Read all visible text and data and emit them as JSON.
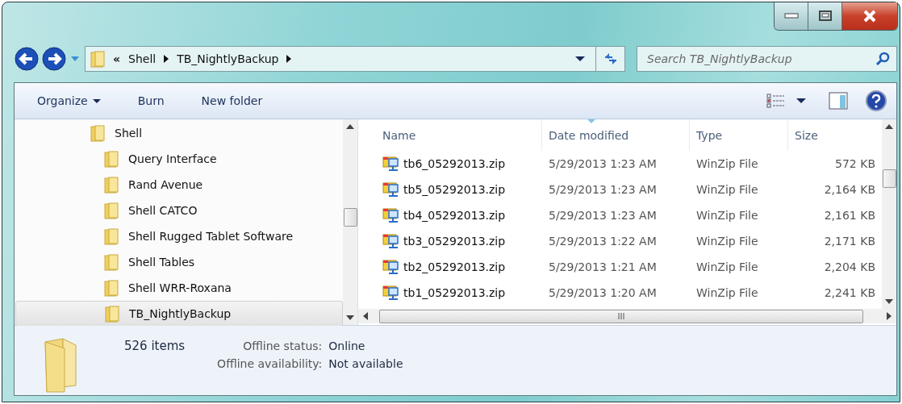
{
  "address": {
    "crumbs": [
      "«",
      "Shell",
      "TB_NightlyBackup"
    ]
  },
  "search": {
    "placeholder": "Search TB_NightlyBackup"
  },
  "toolbar": [
    {
      "label": "Organize",
      "dropdown": true
    },
    {
      "label": "Burn",
      "dropdown": false
    },
    {
      "label": "New folder",
      "dropdown": false
    }
  ],
  "tree": [
    {
      "label": "Shell",
      "selected": false,
      "children": [
        {
          "label": "Query Interface",
          "selected": false
        },
        {
          "label": "Rand Avenue",
          "selected": false
        },
        {
          "label": "Shell CATCO",
          "selected": false
        },
        {
          "label": "Shell Rugged Tablet Software",
          "selected": false
        },
        {
          "label": "Shell Tables",
          "selected": false
        },
        {
          "label": "Shell WRR-Roxana",
          "selected": false
        },
        {
          "label": "TB_NightlyBackup",
          "selected": true
        }
      ]
    }
  ],
  "table": {
    "columns": [
      {
        "label": "Name",
        "sorted": false
      },
      {
        "label": "Date modified",
        "sorted": true
      },
      {
        "label": "Type",
        "sorted": false
      },
      {
        "label": "Size",
        "sorted": false
      }
    ],
    "rows": [
      {
        "name": "tb6_05292013.zip",
        "date": "5/29/2013 1:23 AM",
        "type": "WinZip File",
        "size": "572 KB"
      },
      {
        "name": "tb5_05292013.zip",
        "date": "5/29/2013 1:23 AM",
        "type": "WinZip File",
        "size": "2,164 KB"
      },
      {
        "name": "tb4_05292013.zip",
        "date": "5/29/2013 1:23 AM",
        "type": "WinZip File",
        "size": "2,161 KB"
      },
      {
        "name": "tb3_05292013.zip",
        "date": "5/29/2013 1:22 AM",
        "type": "WinZip File",
        "size": "2,171 KB"
      },
      {
        "name": "tb2_05292013.zip",
        "date": "5/29/2013 1:21 AM",
        "type": "WinZip File",
        "size": "2,204 KB"
      },
      {
        "name": "tb1_05292013.zip",
        "date": "5/29/2013 1:20 AM",
        "type": "WinZip File",
        "size": "2,241 KB"
      }
    ]
  },
  "details": {
    "count": "526 items",
    "fields": [
      {
        "label": "Offline status:",
        "value": "Online"
      },
      {
        "label": "Offline availability:",
        "value": "Not available"
      }
    ]
  }
}
